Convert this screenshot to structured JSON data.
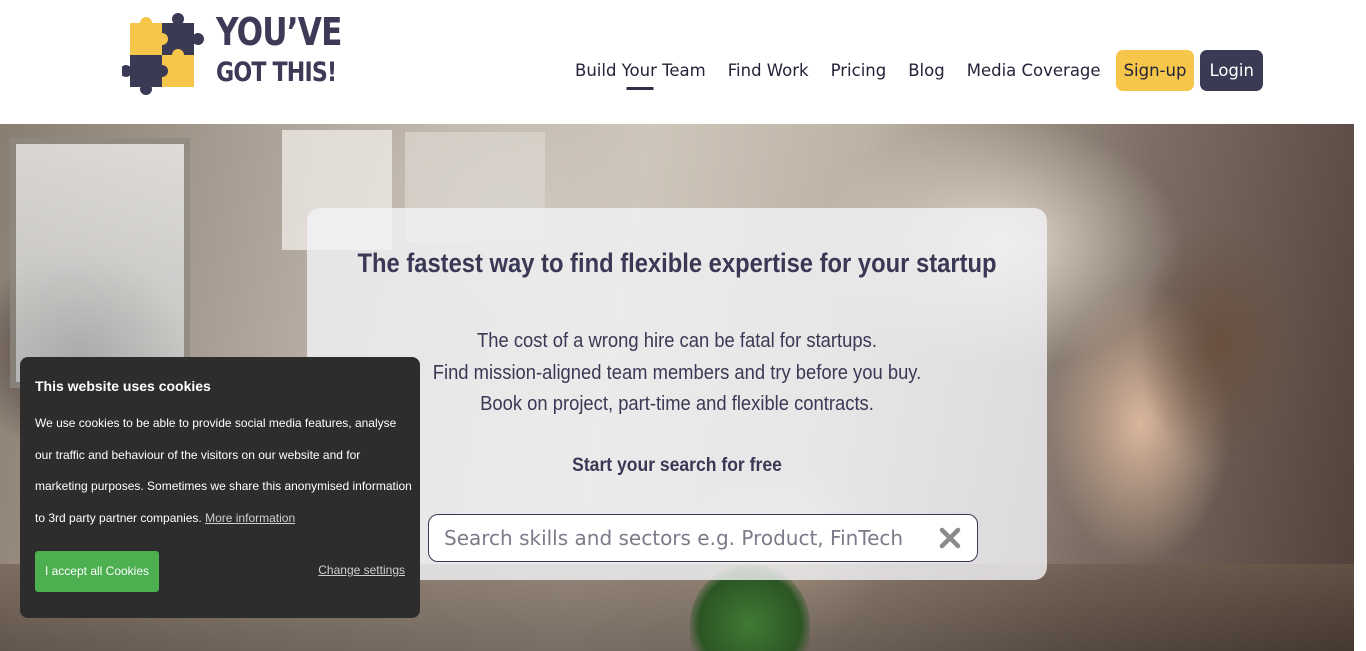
{
  "header": {
    "logo": {
      "line1": "YOU’VE",
      "line2": "GOT THIS!"
    },
    "nav": [
      {
        "label": "Build Your Team",
        "active": true
      },
      {
        "label": "Find Work"
      },
      {
        "label": "Pricing"
      },
      {
        "label": "Blog"
      },
      {
        "label": "Media Coverage"
      }
    ],
    "signup_label": "Sign-up",
    "login_label": "Login"
  },
  "hero": {
    "title": "The fastest way to find flexible expertise for your startup",
    "description": [
      "The cost of a wrong hire can be fatal for startups.",
      "Find mission-aligned team members and try before you buy.",
      "Book on project, part-time and flexible contracts."
    ],
    "cta": "Start your search for free",
    "search": {
      "value": "",
      "placeholder": "Search skills and sectors e.g. Product, FinTech",
      "clear_icon": "close-icon"
    }
  },
  "cookie_banner": {
    "title": "This website uses cookies",
    "text": "We use cookies to be able to provide social media features, analyse our traffic and behaviour of the visitors on our website and for marketing purposes. Sometimes we share this anonymised information to 3rd party partner companies.",
    "more_link": "More information",
    "accept_label": "I accept all Cookies",
    "settings_label": "Change settings"
  },
  "colors": {
    "brand_yellow": "#f6c64a",
    "brand_navy": "#3b3a55",
    "accept_green": "#4caf50"
  }
}
